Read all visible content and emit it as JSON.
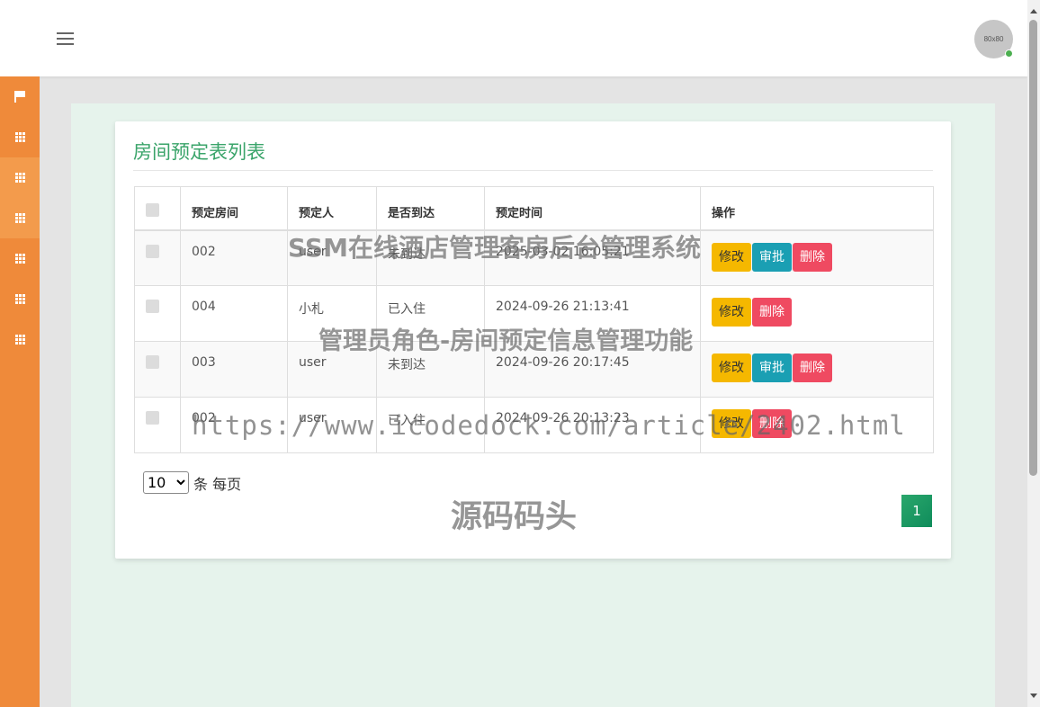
{
  "header": {
    "avatar_text": "80x80"
  },
  "sidebar": {
    "items": [
      {
        "icon": "flag-icon"
      },
      {
        "icon": "grid-icon"
      },
      {
        "icon": "grid-icon"
      },
      {
        "icon": "grid-icon"
      },
      {
        "icon": "grid-icon"
      },
      {
        "icon": "grid-icon"
      },
      {
        "icon": "grid-icon"
      }
    ]
  },
  "main": {
    "title": "房间预定表列表",
    "columns": [
      "",
      "预定房间",
      "预定人",
      "是否到达",
      "预定时间",
      "操作"
    ],
    "rows": [
      {
        "room": "002",
        "person": "user",
        "arrived": "未到达",
        "time": "2025-03-02 16:05:21",
        "actions": [
          "修改",
          "审批",
          "删除"
        ]
      },
      {
        "room": "004",
        "person": "小札",
        "arrived": "已入住",
        "time": "2024-09-26 21:13:41",
        "actions": [
          "修改",
          "删除"
        ]
      },
      {
        "room": "003",
        "person": "user",
        "arrived": "未到达",
        "time": "2024-09-26 20:17:45",
        "actions": [
          "修改",
          "审批",
          "删除"
        ]
      },
      {
        "room": "002",
        "person": "user",
        "arrived": "已入住",
        "time": "2024-09-26 20:13:23",
        "actions": [
          "修改",
          "删除"
        ]
      }
    ],
    "page_size": {
      "selected": "10",
      "label": "条 每页"
    },
    "pagination": {
      "current": "1"
    }
  },
  "watermarks": [
    "SSM在线酒店管理客房后台管理系统",
    "管理员角色-房间预定信息管理功能",
    "https://www.icodedock.com/article/2402.html",
    "源码码头"
  ],
  "colors": {
    "sidebar": "#ef8a3a",
    "title": "#3aa46a",
    "edit_button": "#f5b800",
    "approve_button": "#1a9fb3",
    "delete_button": "#ef4a61",
    "page_active": "#1a9a63"
  }
}
